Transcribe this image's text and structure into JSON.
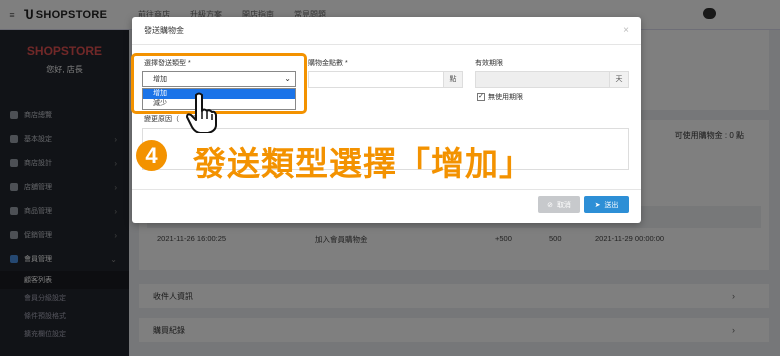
{
  "topbar": {
    "menu_icon": "≡",
    "logo": "SHOPSTORE",
    "nav": [
      "前往商店",
      "升級方案",
      "開店指南",
      "常見問題"
    ]
  },
  "sidebar": {
    "brand": "SHOPSTORE",
    "greeting": "您好, 店長",
    "items": [
      {
        "label": "商店總覽",
        "icon": "dashboard-icon",
        "caret": ""
      },
      {
        "label": "基本設定",
        "icon": "bank-icon",
        "caret": "›"
      },
      {
        "label": "商店設計",
        "icon": "pencil-icon",
        "caret": "›"
      },
      {
        "label": "店舖管理",
        "icon": "store-icon",
        "caret": "›"
      },
      {
        "label": "商品管理",
        "icon": "cart-icon",
        "caret": "›"
      },
      {
        "label": "促銷管理",
        "icon": "gift-icon",
        "caret": "›"
      },
      {
        "label": "會員管理",
        "icon": "users-icon",
        "caret": "⌄"
      }
    ],
    "subitems": [
      "顧客列表",
      "會員分級設定",
      "條件預設格式",
      "擴充欄位設定"
    ]
  },
  "main": {
    "points_note": "可使用購物金 : 0 點",
    "row": {
      "date": "2021-11-26 16:00:25",
      "desc": "加入會員購物金",
      "change": "+500",
      "balance": "500",
      "expire": "2021-11-29 00:00:00"
    },
    "section_recipients": "收件人資訊",
    "section_purchase": "購買紀錄"
  },
  "modal": {
    "title": "發送購物金",
    "close": "×",
    "type_label": "選擇發送類型 *",
    "type_selected": "增加",
    "type_options": [
      "增加",
      "減少"
    ],
    "points_label": "購物金點數 *",
    "points_unit": "點",
    "expire_label": "有效期限",
    "expire_unit": "天",
    "no_expire_label": "無使用期限",
    "no_expire_checked": "✓",
    "reason_label": "變更原因（",
    "reason_label_tail": "須）",
    "cancel": "取消",
    "send": "送出"
  },
  "annotation": {
    "step": "4",
    "caption": "發送類型選擇「增加」"
  },
  "colors": {
    "accent": "#f39200",
    "primary": "#2d8fd6"
  }
}
